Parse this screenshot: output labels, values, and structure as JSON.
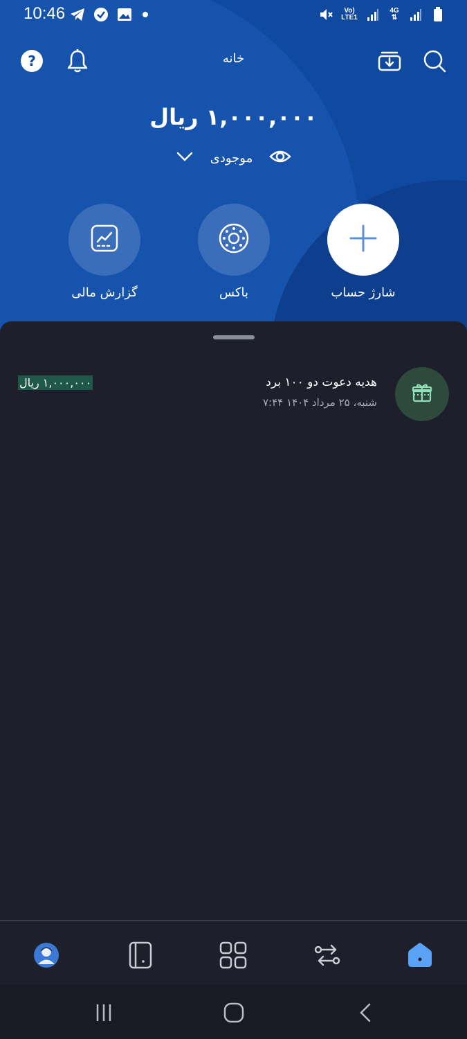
{
  "status_bar": {
    "time": "10:46",
    "left_icons": [
      "telegram-icon",
      "verified-shield-icon",
      "gallery-icon",
      "notification-dot"
    ],
    "right_icons": [
      "mute-icon",
      "volte-lte-icon",
      "signal-icon",
      "4g-icon",
      "signal-icon",
      "battery-icon"
    ],
    "volte_line1": "Vo)",
    "volte_line2": "LTE1",
    "fourg": "4G"
  },
  "header": {
    "title": "خانه",
    "icons": [
      "help-icon",
      "bell-icon",
      "wallet-download-icon",
      "search-icon"
    ]
  },
  "balance": {
    "amount": "۱,۰۰۰,۰۰۰ ریال",
    "label": "موجودی"
  },
  "actions": [
    {
      "label": "شارژ حساب",
      "icon": "plus-icon"
    },
    {
      "label": "باکس",
      "icon": "box-icon"
    },
    {
      "label": "گزارش مالی",
      "icon": "chart-icon"
    }
  ],
  "transactions": [
    {
      "title": "هدیه دعوت دو ۱۰۰ برد",
      "date": "شنبه، ۲۵ مرداد ۱۴۰۴ ۷:۴۴",
      "amount": "۱,۰۰۰,۰۰۰ ریال",
      "icon": "gift-icon"
    }
  ],
  "bottom_nav": {
    "items": [
      "profile-icon",
      "card-icon",
      "apps-icon",
      "transfer-icon",
      "home-icon"
    ],
    "active": "home-icon",
    "accent": "#5aa2f5"
  },
  "colors": {
    "header_blue": "#0f4aa0",
    "sheet_bg": "#1d202b",
    "amount_highlight": "#1f5846"
  }
}
